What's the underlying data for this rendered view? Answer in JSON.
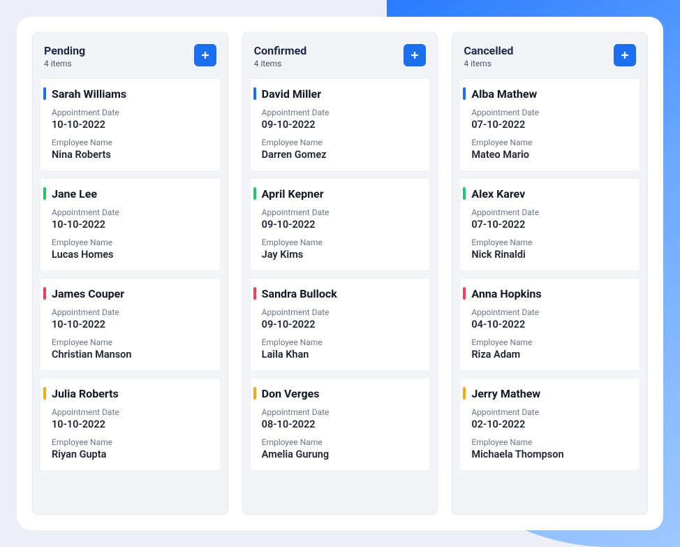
{
  "labels": {
    "appointment_date": "Appointment Date",
    "employee_name": "Employee Name"
  },
  "columns": [
    {
      "title": "Pending",
      "subtitle": "4 items",
      "cards": [
        {
          "tag": "blue",
          "name": "Sarah Williams",
          "date": "10-10-2022",
          "employee": "Nina Roberts"
        },
        {
          "tag": "green",
          "name": "Jane Lee",
          "date": "10-10-2022",
          "employee": "Lucas Homes"
        },
        {
          "tag": "red",
          "name": "James Couper",
          "date": "10-10-2022",
          "employee": "Christian Manson"
        },
        {
          "tag": "orange",
          "name": "Julia Roberts",
          "date": "10-10-2022",
          "employee": "Riyan Gupta"
        }
      ]
    },
    {
      "title": "Confirmed",
      "subtitle": "4 items",
      "cards": [
        {
          "tag": "blue",
          "name": "David Miller",
          "date": "09-10-2022",
          "employee": "Darren Gomez"
        },
        {
          "tag": "green",
          "name": "April Kepner",
          "date": "09-10-2022",
          "employee": "Jay Kims"
        },
        {
          "tag": "red",
          "name": "Sandra Bullock",
          "date": "09-10-2022",
          "employee": "Laila Khan"
        },
        {
          "tag": "orange",
          "name": "Don Verges",
          "date": "08-10-2022",
          "employee": "Amelia Gurung"
        }
      ]
    },
    {
      "title": "Cancelled",
      "subtitle": "4 items",
      "cards": [
        {
          "tag": "blue",
          "name": "Alba Mathew",
          "date": "07-10-2022",
          "employee": "Mateo Mario"
        },
        {
          "tag": "green",
          "name": "Alex Karev",
          "date": "07-10-2022",
          "employee": "Nick Rinaldi"
        },
        {
          "tag": "red",
          "name": "Anna Hopkins",
          "date": "04-10-2022",
          "employee": "Riza Adam"
        },
        {
          "tag": "orange",
          "name": "Jerry Mathew",
          "date": "02-10-2022",
          "employee": "Michaela Thompson"
        }
      ]
    }
  ]
}
